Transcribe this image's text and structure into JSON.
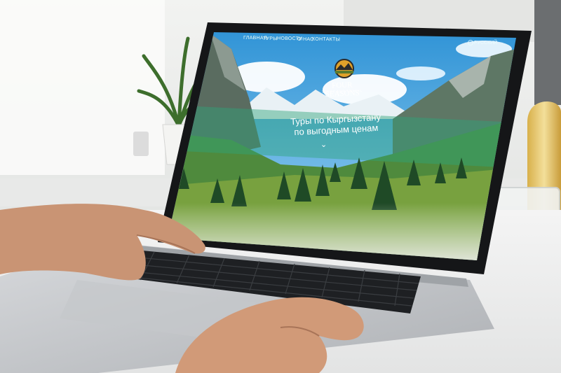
{
  "website": {
    "nav": [
      "ГЛАВНАЯ",
      "ТУРЫ",
      "НОВОСТИ",
      "О НАС",
      "КОНТАКТЫ"
    ],
    "language": "РУССКИЙ",
    "brand": "FOUR SEASONS",
    "tagline": "TOURS AND TRAVEL",
    "headline_line1": "Туры по Кыргызстану",
    "headline_line2": "по выгодным ценам"
  },
  "icons": {
    "globe": "globe-icon",
    "logo": "sunset-mountain-logo",
    "scroll": "chevron-down-icon"
  },
  "colors": {
    "sky": "#4aa7e0",
    "meadow": "#6f9a3b",
    "banner": "#2fa57a",
    "desk": "#eeeeee",
    "laptop": "#c9cbce",
    "keys": "#1f2124"
  }
}
